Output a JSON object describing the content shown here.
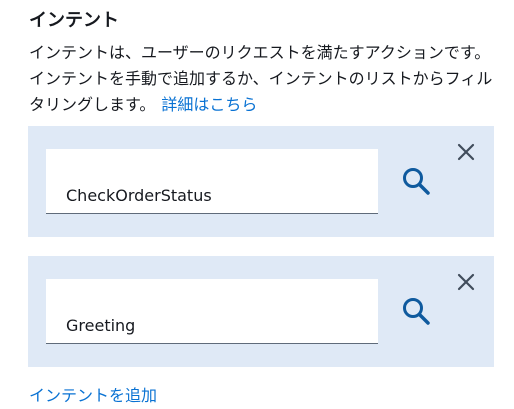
{
  "section": {
    "title": "インテント",
    "description": "インテントは、ユーザーのリクエストを満たすアクションです。インテントを手動で追加するか、インテントのリストからフィルタリングします。",
    "learn_more_link": "詳細はこちら",
    "add_intent_link": "インテントを追加"
  },
  "intents": [
    {
      "value": "CheckOrderStatus",
      "search_icon": "search-icon",
      "remove_icon": "close-icon"
    },
    {
      "value": "Greeting",
      "search_icon": "search-icon",
      "remove_icon": "close-icon"
    }
  ],
  "colors": {
    "text": "#16191f",
    "link": "#0972d3",
    "card_background": "#dfe9f6",
    "icon": "#414d5c",
    "search_icon": "#0f5a9e"
  }
}
